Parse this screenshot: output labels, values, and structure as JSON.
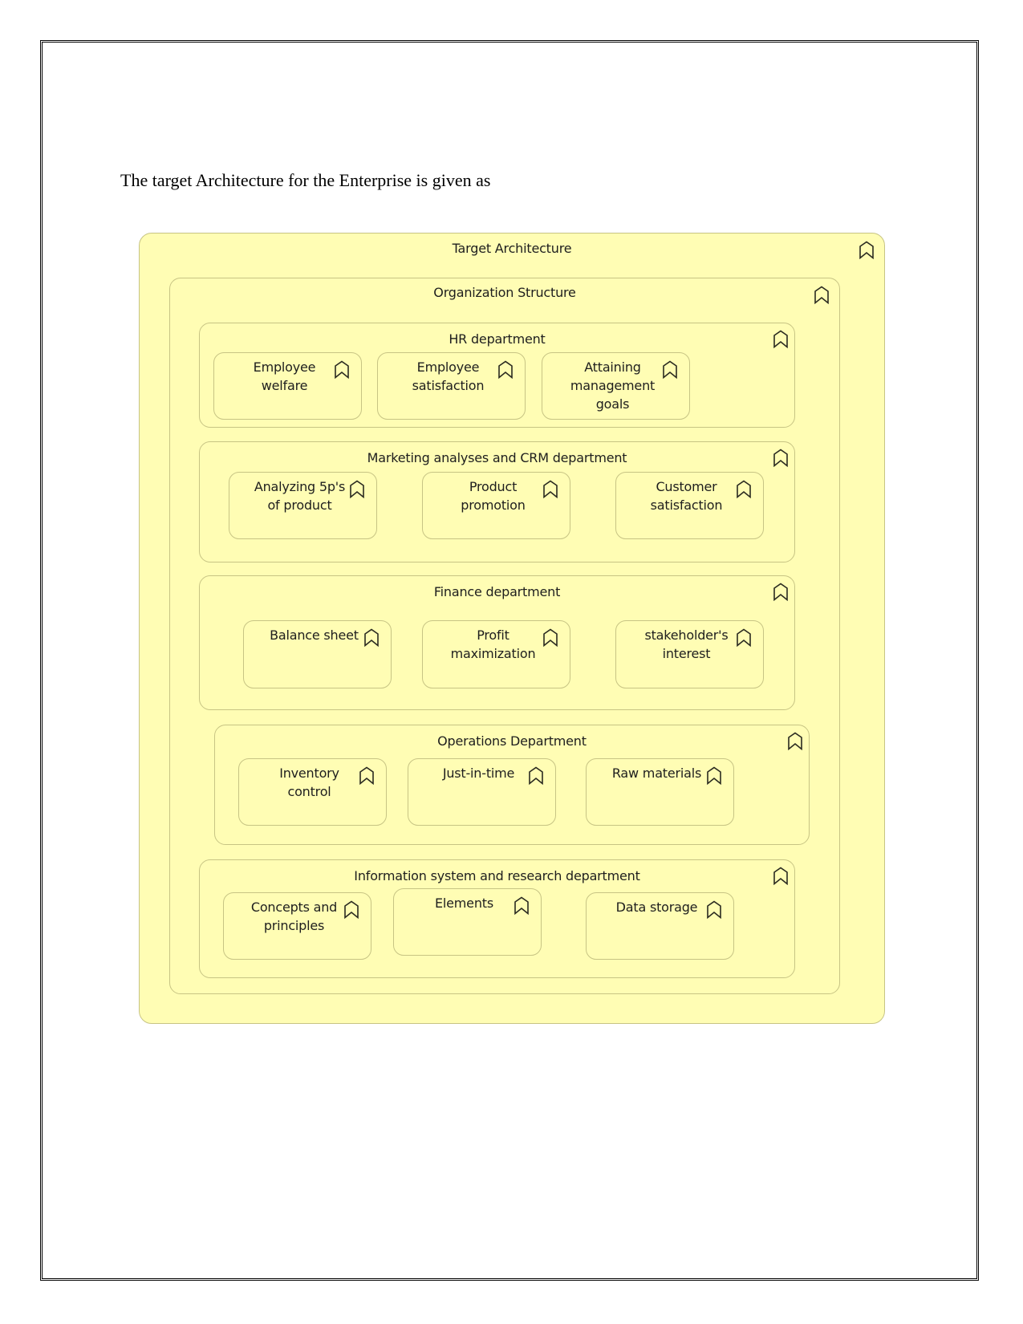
{
  "document": {
    "intro_text": "The target Architecture for the Enterprise is given as"
  },
  "diagram": {
    "colors": {
      "fill": "#fffdb4",
      "border": "#c7c484",
      "icon": "#2a2a20"
    },
    "title": "Target Architecture",
    "icon": "business-function-icon",
    "organization": {
      "title": "Organization Structure",
      "icon": "business-function-icon",
      "departments": [
        {
          "title": "HR department",
          "elements": [
            {
              "lines": [
                "Employee",
                "welfare"
              ]
            },
            {
              "lines": [
                "Employee",
                "satisfaction"
              ]
            },
            {
              "lines": [
                "Attaining",
                "management",
                "goals"
              ]
            }
          ]
        },
        {
          "title": "Marketing analyses and CRM department",
          "elements": [
            {
              "lines": [
                "Analyzing 5p's",
                "of product"
              ]
            },
            {
              "lines": [
                "Product",
                "promotion"
              ]
            },
            {
              "lines": [
                "Customer",
                "satisfaction"
              ]
            }
          ]
        },
        {
          "title": "Finance department",
          "elements": [
            {
              "lines": [
                "Balance sheet"
              ]
            },
            {
              "lines": [
                "Profit",
                "maximization"
              ]
            },
            {
              "lines": [
                "stakeholder's",
                "interest"
              ]
            }
          ]
        },
        {
          "title": "Operations Department",
          "elements": [
            {
              "lines": [
                "Inventory",
                "control"
              ]
            },
            {
              "lines": [
                "Just-in-time"
              ]
            },
            {
              "lines": [
                "Raw materials"
              ]
            }
          ]
        },
        {
          "title": "Information system and research department",
          "elements": [
            {
              "lines": [
                "Concepts and",
                "principles"
              ]
            },
            {
              "lines": [
                "Elements"
              ]
            },
            {
              "lines": [
                "Data storage"
              ]
            }
          ]
        }
      ]
    }
  }
}
